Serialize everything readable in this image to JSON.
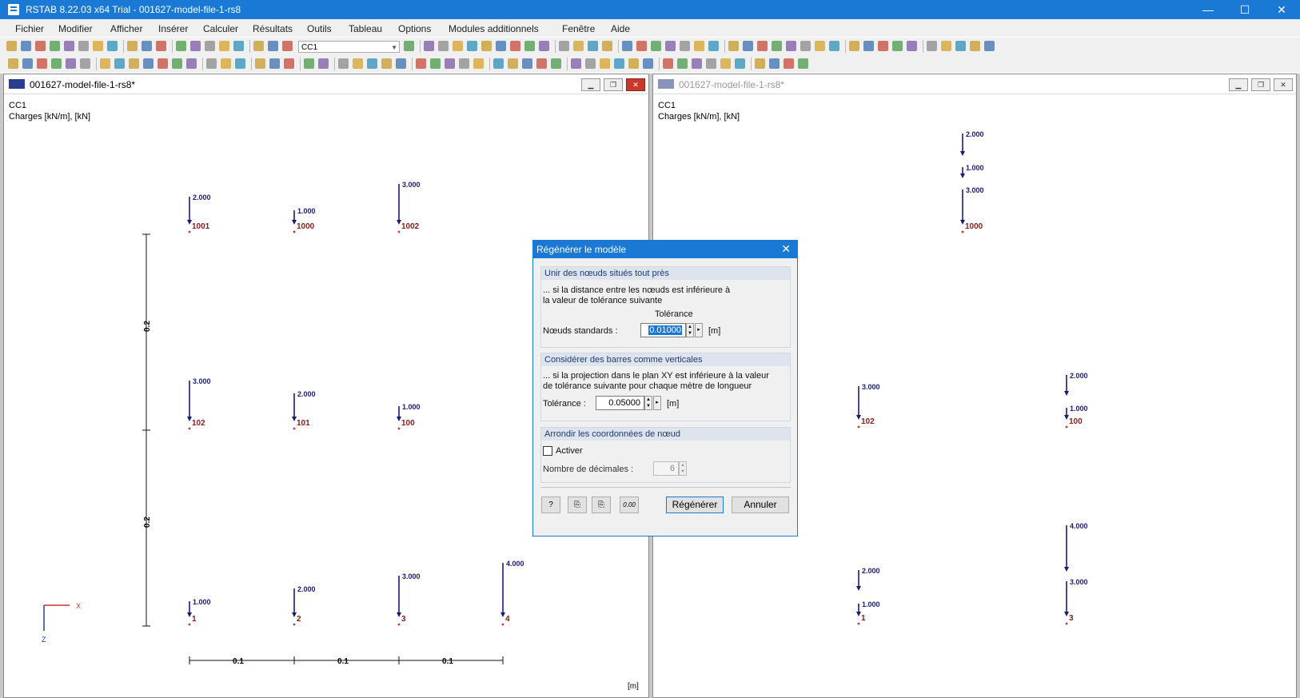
{
  "window": {
    "title": "RSTAB 8.22.03 x64 Trial - 001627-model-file-1-rs8",
    "min_glyph": "—",
    "max_glyph": "☐",
    "close_glyph": "✕"
  },
  "menu": [
    "Fichier",
    "Modifier",
    "Afficher",
    "Insérer",
    "Calculer",
    "Résultats",
    "Outils",
    "Tableau",
    "Options",
    "Modules additionnels",
    "Fenêtre",
    "Aide"
  ],
  "toolbar": {
    "load_case": "CC1"
  },
  "left_view": {
    "title": "001627-model-file-1-rs8*",
    "header_line1": "CC1",
    "header_line2": "Charges [kN/m], [kN]",
    "units": "[m]",
    "axis_x": "X",
    "axis_z": "Z",
    "dim_vertical": [
      "0.2",
      "0.2"
    ],
    "dim_horizontal": [
      "0.1",
      "0.1",
      "0.1"
    ],
    "nodes": [
      {
        "label": "1001",
        "load": "2.000"
      },
      {
        "label": "1000",
        "load": "1.000"
      },
      {
        "label": "1002",
        "load": "3.000"
      },
      {
        "label": "102",
        "load": "3.000"
      },
      {
        "label": "101",
        "load": "2.000"
      },
      {
        "label": "100",
        "load": "1.000"
      },
      {
        "label": "1",
        "load": "1.000"
      },
      {
        "label": "2",
        "load": "2.000"
      },
      {
        "label": "3",
        "load": "3.000"
      },
      {
        "label": "4",
        "load": "4.000"
      }
    ]
  },
  "right_view": {
    "title": "001627-model-file-1-rs8*",
    "header_line1": "CC1",
    "header_line2": "Charges [kN/m], [kN]",
    "top_loads": [
      "2.000",
      "1.000",
      "3.000"
    ],
    "top_node": "1000",
    "nodes": [
      {
        "label": "102",
        "load": "3.000"
      },
      {
        "label": "100",
        "loads": [
          "2.000",
          "1.000"
        ]
      },
      {
        "label": "1",
        "loads": [
          "2.000",
          "1.000"
        ]
      },
      {
        "label": "3",
        "loads": [
          "4.000",
          "3.000"
        ]
      }
    ]
  },
  "dialog": {
    "title": "Régénérer le modèle",
    "group1": {
      "header": "Unir des nœuds situés tout près",
      "desc1": "... si la distance entre les nœuds est inférieure à",
      "desc2": "la valeur de tolérance suivante",
      "col_header": "Tolérance",
      "field_label": "Nœuds standards :",
      "value": "0.01000",
      "unit": "[m]"
    },
    "group2": {
      "header": "Considérer des barres comme verticales",
      "desc1": "... si la projection dans le plan XY est inférieure à la valeur",
      "desc2": "de tolérance suivante pour chaque mètre de longueur",
      "field_label": "Tolérance :",
      "value": "0.05000",
      "unit": "[m]"
    },
    "group3": {
      "header": "Arrondir les coordonnées de nœud",
      "checkbox_label": "Activer",
      "decimals_label": "Nombre de décimales :",
      "decimals_value": "6"
    },
    "icon_zero": "0.00",
    "btn_ok": "Régénérer",
    "btn_cancel": "Annuler"
  },
  "colors": {
    "accent": "#1b79d6",
    "load_arrow": "#1a1a7a",
    "node_label": "#8b1a1a"
  }
}
